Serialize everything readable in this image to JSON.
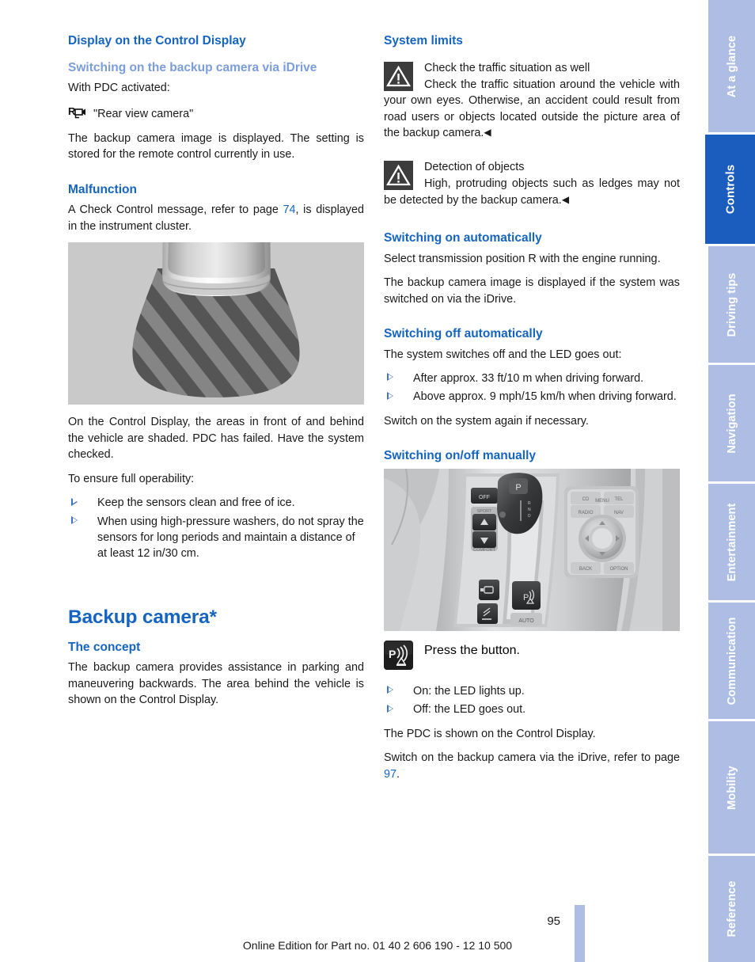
{
  "document": {
    "page_number": "95",
    "footer_note": "Online Edition for Part no. 01 40 2 606 190 - 12 10 500"
  },
  "left_column": {
    "heading_display": "Display on the Control Display",
    "subheading_switch_idrive": "Switching on the backup camera via iDrive",
    "para_with_pdc": "With PDC activated:",
    "idrive_menu_icon": "rear-view-camera-icon",
    "idrive_menu_item": "\"Rear view camera\"",
    "para_image_displayed": "The backup camera image is displayed. The setting is stored for the remote control currently in use.",
    "heading_malfunction": "Malfunction",
    "para_check_control_pre": "A Check Control message, refer to page ",
    "para_check_control_ref": "74",
    "para_check_control_post": ", is displayed in the instrument cluster.",
    "figure_pdc_failed_caption": "top-view-vehicle-shaded-areas",
    "para_shaded": "On the Control Display, the areas in front of and behind the vehicle are shaded. PDC has failed. Have the system checked.",
    "para_ensure": "To ensure full operability:",
    "bullets_operability": [
      "Keep the sensors clean and free of ice.",
      "When using high-pressure washers, do not spray the sensors for long periods and maintain a distance of at least 12 in/30 cm."
    ],
    "chapter_title": "Backup camera*",
    "heading_concept": "The concept",
    "para_concept": "The backup camera provides assistance in parking and maneuvering backwards. The area behind the vehicle is shown on the Control Display."
  },
  "right_column": {
    "heading_system_limits": "System limits",
    "warning_1": {
      "icon": "warning-triangle-icon",
      "title": "Check the traffic situation as well",
      "text": "Check the traffic situation around the vehicle with your own eyes. Otherwise, an accident could result from road users or objects located outside the picture area of the backup camera.",
      "end_marker": "◀"
    },
    "warning_2": {
      "icon": "warning-triangle-icon",
      "title": "Detection of objects",
      "text": "High, protruding objects such as ledges may not be detected by the backup camera.",
      "end_marker": "◀"
    },
    "heading_switch_on_auto": "Switching on automatically",
    "para_select_r": "Select transmission position R with the engine running.",
    "para_image_displayed_auto": "The backup camera image is displayed if the system was switched on via the iDrive.",
    "heading_switch_off_auto": "Switching off automatically",
    "para_switches_off": "The system switches off and the LED goes out:",
    "bullets_switch_off": [
      "After approx. 33 ft/10 m when driving forward.",
      "Above approx. 9 mph/15 km/h when driving forward."
    ],
    "para_switch_again": "Switch on the system again if necessary.",
    "heading_switch_manual": "Switching on/off manually",
    "figure_console_caption": "center-console-pdc-button-photo",
    "press_button": {
      "icon": "pdc-button-icon",
      "label": "Press the button."
    },
    "bullets_led": [
      "On: the LED lights up.",
      "Off: the LED goes out."
    ],
    "para_pdc_shown": "The PDC is shown on the Control Display.",
    "para_switch_idrive_pre": "Switch on the backup camera via the iDrive, refer to page ",
    "para_switch_idrive_ref": "97",
    "para_switch_idrive_post": "."
  },
  "rail": {
    "tabs": [
      {
        "label": "At a glance",
        "active": false
      },
      {
        "label": "Controls",
        "active": true
      },
      {
        "label": "Driving tips",
        "active": false
      },
      {
        "label": "Navigation",
        "active": false
      },
      {
        "label": "Entertainment",
        "active": false
      },
      {
        "label": "Communication",
        "active": false
      },
      {
        "label": "Mobility",
        "active": false
      },
      {
        "label": "Reference",
        "active": false
      }
    ]
  },
  "colors": {
    "heading_blue": "#1565c0",
    "subheading_blue": "#7b9ddb",
    "tab_inactive": "#aebde4",
    "tab_active": "#1b5cbf",
    "bullet_blue": "#3f73c4",
    "warning_icon_bg": "#3c3c3c"
  }
}
